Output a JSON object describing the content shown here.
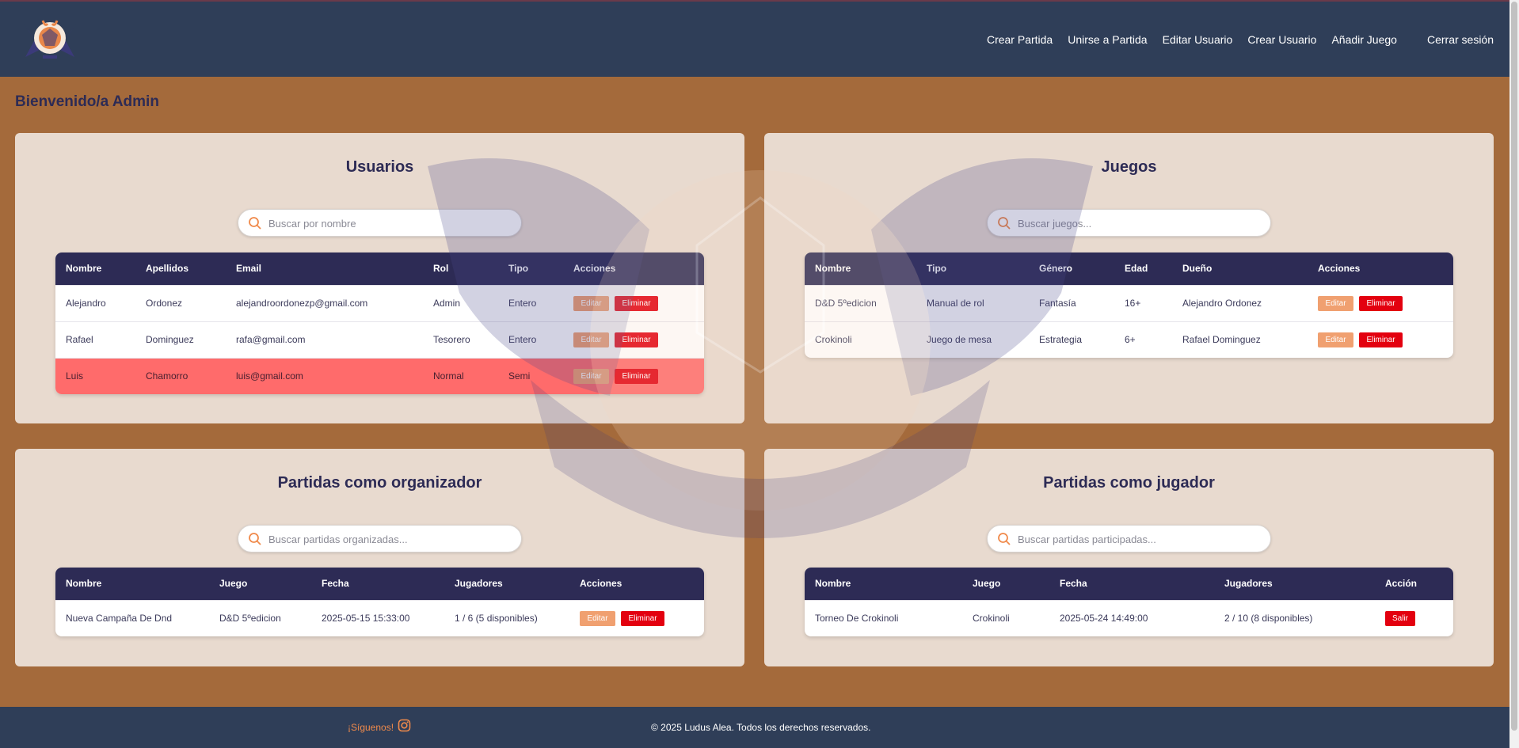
{
  "nav": {
    "items": [
      "Crear Partida",
      "Unirse a Partida",
      "Editar Usuario",
      "Crear Usuario",
      "Añadir Juego"
    ],
    "logout": "Cerrar sesión"
  },
  "welcome": "Bienvenido/a Admin",
  "users": {
    "title": "Usuarios",
    "search_placeholder": "Buscar por nombre",
    "columns": [
      "Nombre",
      "Apellidos",
      "Email",
      "Rol",
      "Tipo",
      "Acciones"
    ],
    "rows": [
      {
        "nombre": "Alejandro",
        "apellidos": "Ordonez",
        "email": "alejandroordonezp@gmail.com",
        "rol": "Admin",
        "tipo": "Entero"
      },
      {
        "nombre": "Rafael",
        "apellidos": "Dominguez",
        "email": "rafa@gmail.com",
        "rol": "Tesorero",
        "tipo": "Entero"
      },
      {
        "nombre": "Luis",
        "apellidos": "Chamorro",
        "email": "luis@gmail.com",
        "rol": "Normal",
        "tipo": "Semi"
      }
    ]
  },
  "games": {
    "title": "Juegos",
    "search_placeholder": "Buscar juegos...",
    "columns": [
      "Nombre",
      "Tipo",
      "Género",
      "Edad",
      "Dueño",
      "Acciones"
    ],
    "rows": [
      {
        "nombre": "D&D 5ºedicion",
        "tipo": "Manual de rol",
        "genero": "Fantasía",
        "edad": "16+",
        "dueno": "Alejandro Ordonez"
      },
      {
        "nombre": "Crokinoli",
        "tipo": "Juego de mesa",
        "genero": "Estrategia",
        "edad": "6+",
        "dueno": "Rafael Dominguez"
      }
    ]
  },
  "organizer": {
    "title": "Partidas como organizador",
    "search_placeholder": "Buscar partidas organizadas...",
    "columns": [
      "Nombre",
      "Juego",
      "Fecha",
      "Jugadores",
      "Acciones"
    ],
    "rows": [
      {
        "nombre": "Nueva Campaña De Dnd",
        "juego": "D&D 5ºedicion",
        "fecha": "2025-05-15 15:33:00",
        "jugadores": "1 / 6 (5 disponibles)"
      }
    ]
  },
  "player": {
    "title": "Partidas como jugador",
    "search_placeholder": "Buscar partidas participadas...",
    "columns": [
      "Nombre",
      "Juego",
      "Fecha",
      "Jugadores",
      "Acción"
    ],
    "rows": [
      {
        "nombre": "Torneo De Crokinoli",
        "juego": "Crokinoli",
        "fecha": "2025-05-24 14:49:00",
        "jugadores": "2 / 10 (8 disponibles)"
      }
    ]
  },
  "buttons": {
    "edit": "Editar",
    "delete": "Eliminar",
    "leave": "Salir"
  },
  "footer": {
    "follow": "¡Síguenos!",
    "copyright": "© 2025 Ludus Alea. Todos los derechos reservados."
  },
  "colors": {
    "navbar": "#2f3e58",
    "background": "#a46a3b",
    "table_header": "#2d2b55",
    "edit": "#f0a070",
    "delete": "#e3000f",
    "highlight_row": "#ff6b6b"
  },
  "icons": {
    "search": "search-icon",
    "instagram": "instagram-icon",
    "logo": "ludus-alea-logo"
  }
}
